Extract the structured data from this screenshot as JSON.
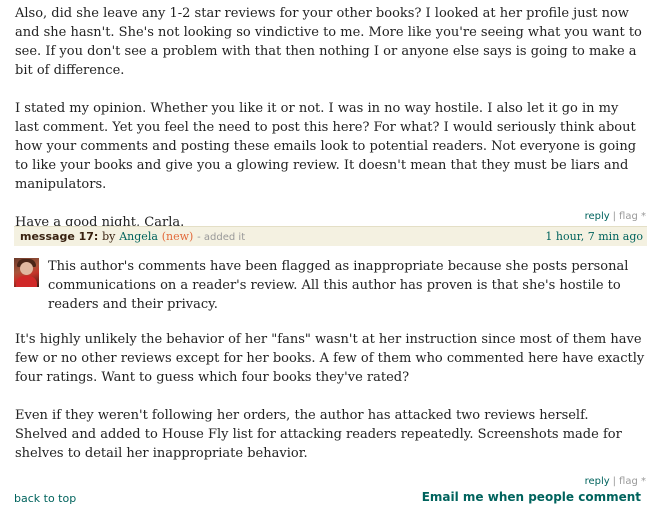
{
  "previous_message": {
    "paragraphs": [
      "Also, did she leave any 1-2 star reviews for your other books? I looked at her profile just now and she hasn't. She's not looking so vindictive to me. More like you're seeing what you want to see. If you don't see a problem with that then nothing I or anyone else says is going to make a bit of difference.",
      "I stated my opinion. Whether you like it or not. I was in no way hostile. I also let it go in my last comment. Yet you feel the need to post this here? For what? I would seriously think about how your comments and posting these emails look to potential readers. Not everyone is going to like your books and give you a glowing review. It doesn't mean that they must be liars and manipulators.",
      "Have a good night, Carla."
    ],
    "actions": {
      "reply": "reply",
      "flag": "flag *"
    }
  },
  "message": {
    "label": "message 17:",
    "by": "by",
    "author": "Angela",
    "new_tag": "(new)",
    "added": "- added it",
    "time": "1 hour, 7 min ago",
    "intro": "This author's comments have been flagged as inappropriate because she posts personal communications on a reader's review. All this author has proven is that she's hostile to readers and their privacy.",
    "paragraphs": [
      "It's highly unlikely the behavior of her \"fans\" wasn't at her instruction since most of them have few or no other reviews except for her books. A few of them who commented here have exactly four ratings. Want to guess which four books they've rated?",
      "Even if they weren't following her orders, the author has attacked two reviews herself. Shelved and added to House Fly list for attacking readers repeatedly. Screenshots made for shelves to detail her inappropriate behavior."
    ],
    "actions": {
      "reply": "reply",
      "flag": "flag *"
    }
  },
  "footer": {
    "back_to_top": "back to top",
    "email_me": "Email me when people comment"
  }
}
